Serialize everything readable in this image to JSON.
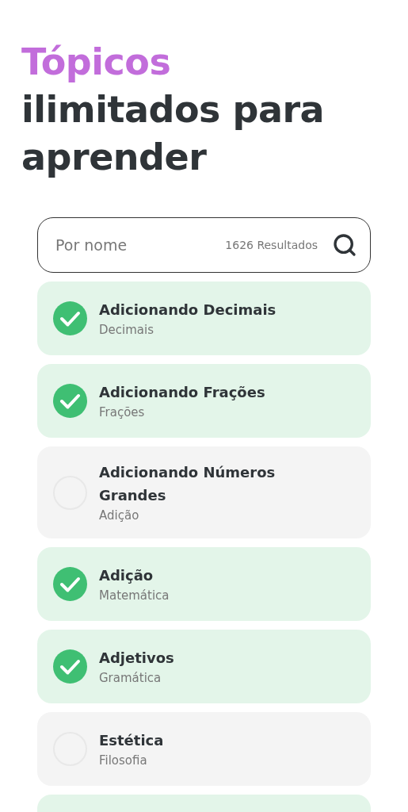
{
  "heading": {
    "highlight": "Tópicos",
    "rest": "ilimitados para aprender"
  },
  "search": {
    "placeholder": "Por nome",
    "count": "1626 Resultados"
  },
  "items": [
    {
      "title": "Adicionando Decimais",
      "subtitle": "Decimais",
      "checked": true
    },
    {
      "title": "Adicionando Frações",
      "subtitle": "Frações",
      "checked": true
    },
    {
      "title": "Adicionando Números Grandes",
      "subtitle": "Adição",
      "checked": false
    },
    {
      "title": "Adição",
      "subtitle": "Matemática",
      "checked": true
    },
    {
      "title": "Adjetivos",
      "subtitle": "Gramática",
      "checked": true
    },
    {
      "title": "Estética",
      "subtitle": "Filosofia",
      "checked": false
    },
    {
      "checked": true
    }
  ]
}
